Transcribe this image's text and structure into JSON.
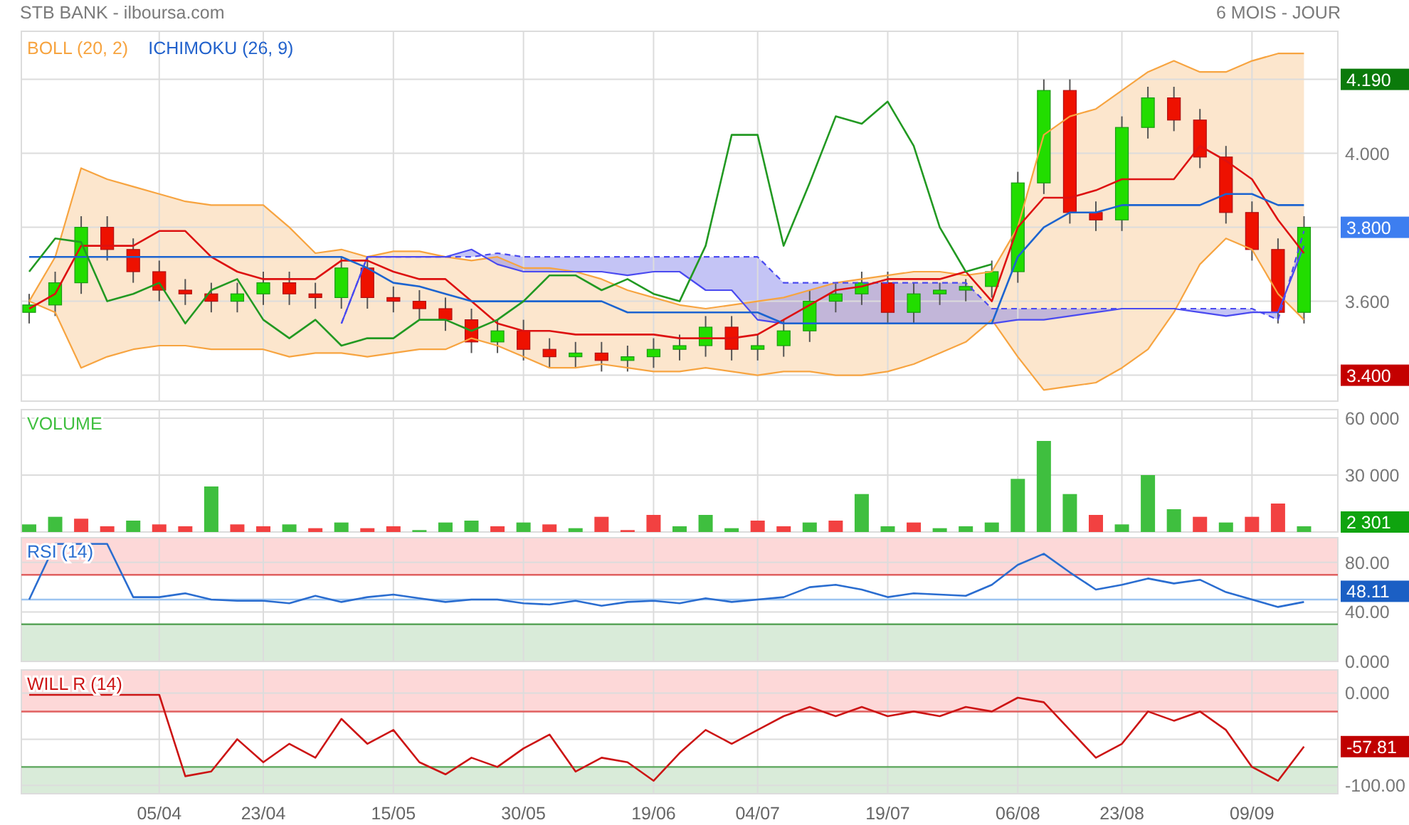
{
  "header": {
    "title": "STB BANK - ilboursa.com",
    "period": "6 MOIS - JOUR"
  },
  "price_panel": {
    "indicators": [
      {
        "label": "BOLL (20, 2)",
        "color": "#f7a440"
      },
      {
        "label": "ICHIMOKU (26, 9)",
        "color": "#2262cc"
      }
    ],
    "badges": [
      {
        "color": "#c40000"
      },
      {
        "color": "#3d7ef0"
      },
      {
        "color": "#0b7a0b"
      }
    ],
    "candles": {
      "chart_data": {
        "type": "candlestick",
        "grid": true,
        "categories": [
          null,
          null,
          null,
          null,
          null,
          null,
          null,
          null,
          null,
          null,
          null,
          null,
          null,
          null,
          null,
          null,
          null,
          null,
          null,
          null,
          null,
          null,
          null,
          null,
          null,
          null,
          null,
          null,
          null,
          null,
          null,
          null,
          null,
          null,
          null,
          null,
          null,
          null,
          null,
          null,
          null,
          null,
          null,
          null,
          null,
          null,
          null,
          null,
          null,
          null
        ],
        "ylim": [
          3.33,
          4.33
        ],
        "yticks": [
          {
            "value": 3.4,
            "label": "3.400"
          },
          {
            "value": 3.8,
            "label": "3.800"
          }
        ],
        "ohlc": [
          [
            3.57,
            3.62,
            3.54,
            3.59
          ],
          [
            3.59,
            3.68,
            3.56,
            3.65
          ],
          [
            3.65,
            3.83,
            3.62,
            3.8
          ],
          [
            3.8,
            3.83,
            3.71,
            3.74
          ],
          [
            3.74,
            3.77,
            3.65,
            3.68
          ],
          [
            3.68,
            3.71,
            3.6,
            3.63
          ],
          [
            3.63,
            3.66,
            3.59,
            3.62
          ],
          [
            3.62,
            3.65,
            3.57,
            3.6
          ],
          [
            3.6,
            3.65,
            3.57,
            3.62
          ],
          [
            3.62,
            3.68,
            3.59,
            3.65
          ],
          [
            3.65,
            3.68,
            3.59,
            3.62
          ],
          [
            3.62,
            3.65,
            3.58,
            3.61
          ],
          [
            3.61,
            3.72,
            3.58,
            3.69
          ],
          [
            3.69,
            3.72,
            3.58,
            3.61
          ],
          [
            3.61,
            3.64,
            3.57,
            3.6
          ],
          [
            3.6,
            3.63,
            3.55,
            3.58
          ],
          [
            3.58,
            3.61,
            3.52,
            3.55
          ],
          [
            3.55,
            3.58,
            3.46,
            3.49
          ],
          [
            3.49,
            3.55,
            3.46,
            3.52
          ],
          [
            3.52,
            3.55,
            3.44,
            3.47
          ],
          [
            3.47,
            3.5,
            3.42,
            3.45
          ],
          [
            3.45,
            3.49,
            3.42,
            3.46
          ],
          [
            3.46,
            3.49,
            3.41,
            3.44
          ],
          [
            3.44,
            3.48,
            3.41,
            3.45
          ],
          [
            3.45,
            3.5,
            3.42,
            3.47
          ],
          [
            3.47,
            3.51,
            3.44,
            3.48
          ],
          [
            3.48,
            3.56,
            3.45,
            3.53
          ],
          [
            3.53,
            3.56,
            3.44,
            3.47
          ],
          [
            3.47,
            3.51,
            3.44,
            3.48
          ],
          [
            3.48,
            3.55,
            3.45,
            3.52
          ],
          [
            3.52,
            3.63,
            3.49,
            3.6
          ],
          [
            3.6,
            3.65,
            3.57,
            3.62
          ],
          [
            3.62,
            3.68,
            3.59,
            3.65
          ],
          [
            3.65,
            3.68,
            3.54,
            3.57
          ],
          [
            3.57,
            3.65,
            3.54,
            3.62
          ],
          [
            3.62,
            3.65,
            3.59,
            3.63
          ],
          [
            3.63,
            3.66,
            3.6,
            3.64
          ],
          [
            3.64,
            3.71,
            3.61,
            3.68
          ],
          [
            3.68,
            3.95,
            3.65,
            3.92
          ],
          [
            3.92,
            4.2,
            3.89,
            4.17
          ],
          [
            4.17,
            4.2,
            3.81,
            3.84
          ],
          [
            3.84,
            3.87,
            3.79,
            3.82
          ],
          [
            3.82,
            4.1,
            3.79,
            4.07
          ],
          [
            4.07,
            4.18,
            4.04,
            4.15
          ],
          [
            4.15,
            4.18,
            4.06,
            4.09
          ],
          [
            4.09,
            4.12,
            3.96,
            3.99
          ],
          [
            3.99,
            4.02,
            3.81,
            3.84
          ],
          [
            3.84,
            3.87,
            3.71,
            3.74
          ],
          [
            3.74,
            3.77,
            3.54,
            3.57
          ],
          [
            3.57,
            3.83,
            3.54,
            3.8
          ]
        ],
        "annotations": [
          "4.190"
        ]
      }
    },
    "overlays": {
      "chart_data": {
        "type": "line",
        "categories": [
          null,
          null,
          null,
          null,
          null,
          null,
          null,
          null,
          null,
          null,
          null,
          null,
          null,
          null,
          null,
          null,
          null,
          null,
          null,
          null,
          null,
          null,
          null,
          null,
          null,
          null,
          null,
          null,
          null,
          null,
          null,
          null,
          null,
          null,
          null,
          null,
          null,
          null,
          null,
          null,
          null,
          null,
          null,
          null,
          null,
          null,
          null,
          null,
          null,
          null
        ],
        "ylim": [
          3.33,
          4.33
        ],
        "yticks": [
          {
            "value": 3.6,
            "label": "3.600"
          },
          {
            "value": 4.0,
            "label": "4.000"
          }
        ],
        "series": [
          {
            "color": "#f7a440",
            "values": [
              3.6,
              3.72,
              3.96,
              3.93,
              3.91,
              3.89,
              3.87,
              3.86,
              3.86,
              3.86,
              3.8,
              3.73,
              3.74,
              3.72,
              3.735,
              3.735,
              3.72,
              3.71,
              3.72,
              3.69,
              3.69,
              3.68,
              3.66,
              3.63,
              3.61,
              3.59,
              3.58,
              3.59,
              3.6,
              3.61,
              3.63,
              3.65,
              3.66,
              3.67,
              3.68,
              3.68,
              3.67,
              3.68,
              3.8,
              4.05,
              4.1,
              4.12,
              4.17,
              4.22,
              4.25,
              4.22,
              4.22,
              4.25,
              4.27,
              4.27
            ]
          },
          {
            "color": "#f7a440",
            "values": [
              3.6,
              3.57,
              3.42,
              3.45,
              3.47,
              3.48,
              3.48,
              3.47,
              3.47,
              3.47,
              3.45,
              3.46,
              3.46,
              3.45,
              3.46,
              3.47,
              3.47,
              3.5,
              3.48,
              3.45,
              3.42,
              3.42,
              3.43,
              3.42,
              3.41,
              3.41,
              3.42,
              3.41,
              3.4,
              3.41,
              3.41,
              3.4,
              3.4,
              3.41,
              3.43,
              3.46,
              3.49,
              3.55,
              3.45,
              3.36,
              3.37,
              3.38,
              3.42,
              3.47,
              3.57,
              3.7,
              3.77,
              3.74,
              3.62,
              3.55
            ]
          },
          {
            "color": "#4a4af0",
            "line_style": "dashed",
            "values": [
              null,
              null,
              null,
              null,
              null,
              null,
              null,
              null,
              null,
              null,
              null,
              null,
              3.54,
              3.72,
              3.72,
              3.72,
              3.72,
              3.72,
              3.73,
              3.72,
              3.72,
              3.72,
              3.72,
              3.72,
              3.72,
              3.72,
              3.72,
              3.72,
              3.72,
              3.65,
              3.65,
              3.65,
              3.65,
              3.65,
              3.65,
              3.65,
              3.65,
              3.58,
              3.58,
              3.58,
              3.58,
              3.58,
              3.58,
              3.58,
              3.58,
              3.58,
              3.58,
              3.58,
              3.55,
              3.79
            ]
          },
          {
            "color": "#4a4af0",
            "values": [
              null,
              null,
              null,
              null,
              null,
              null,
              null,
              null,
              null,
              null,
              null,
              null,
              3.54,
              3.72,
              3.72,
              3.72,
              3.72,
              3.74,
              3.7,
              3.68,
              3.68,
              3.68,
              3.68,
              3.67,
              3.68,
              3.68,
              3.63,
              3.63,
              3.55,
              3.54,
              3.54,
              3.54,
              3.54,
              3.54,
              3.54,
              3.54,
              3.54,
              3.54,
              3.55,
              3.55,
              3.56,
              3.57,
              3.58,
              3.58,
              3.58,
              3.57,
              3.56,
              3.57,
              3.57,
              3.75
            ]
          },
          {
            "color": "#dd1111",
            "values": [
              3.58,
              3.62,
              3.75,
              3.75,
              3.75,
              3.79,
              3.79,
              3.72,
              3.68,
              3.66,
              3.66,
              3.66,
              3.71,
              3.71,
              3.68,
              3.66,
              3.66,
              3.6,
              3.54,
              3.52,
              3.52,
              3.51,
              3.51,
              3.51,
              3.51,
              3.5,
              3.5,
              3.5,
              3.51,
              3.55,
              3.59,
              3.63,
              3.64,
              3.66,
              3.66,
              3.66,
              3.68,
              3.6,
              3.8,
              3.88,
              3.88,
              3.9,
              3.93,
              3.93,
              3.93,
              4.02,
              3.98,
              3.93,
              3.82,
              3.73
            ]
          },
          {
            "color": "#1c64d0",
            "values": [
              3.72,
              3.72,
              3.72,
              3.72,
              3.72,
              3.72,
              3.72,
              3.72,
              3.72,
              3.72,
              3.72,
              3.72,
              3.72,
              3.69,
              3.65,
              3.64,
              3.62,
              3.6,
              3.6,
              3.6,
              3.6,
              3.6,
              3.6,
              3.57,
              3.57,
              3.57,
              3.57,
              3.57,
              3.57,
              3.54,
              3.54,
              3.54,
              3.54,
              3.54,
              3.54,
              3.54,
              3.54,
              3.54,
              3.72,
              3.8,
              3.84,
              3.84,
              3.86,
              3.86,
              3.86,
              3.86,
              3.89,
              3.89,
              3.86,
              3.86
            ]
          },
          {
            "color": "#229922",
            "values": [
              3.68,
              3.77,
              3.76,
              3.6,
              3.62,
              3.65,
              3.54,
              3.63,
              3.66,
              3.55,
              3.5,
              3.55,
              3.48,
              3.5,
              3.5,
              3.55,
              3.55,
              3.52,
              3.55,
              3.6,
              3.67,
              3.67,
              3.63,
              3.66,
              3.62,
              3.6,
              3.75,
              4.05,
              4.05,
              3.75,
              3.92,
              4.1,
              4.08,
              4.14,
              4.02,
              3.8,
              3.68,
              3.7,
              null,
              null,
              null,
              null,
              null,
              null,
              null,
              null,
              null,
              null,
              null,
              null
            ]
          }
        ]
      }
    }
  },
  "volume_panel": {
    "badges": [
      {
        "color": "#0fa40f"
      }
    ],
    "chart_data": {
      "type": "bar",
      "title": "VOLUME",
      "grid": true,
      "categories": [
        null,
        null,
        null,
        null,
        null,
        null,
        null,
        null,
        null,
        null,
        null,
        null,
        null,
        null,
        null,
        null,
        null,
        null,
        null,
        null,
        null,
        null,
        null,
        null,
        null,
        null,
        null,
        null,
        null,
        null,
        null,
        null,
        null,
        null,
        null,
        null,
        null,
        null,
        null,
        null,
        null,
        null,
        null,
        null,
        null,
        null,
        null,
        null,
        null,
        null
      ],
      "ylim": [
        0,
        64500
      ],
      "yticks": [
        {
          "value": 30000,
          "label": "30 000"
        },
        {
          "value": 60000,
          "label": "60 000"
        }
      ],
      "series": [
        {
          "color": "#3fbf3f",
          "values": [
            4000,
            8000,
            null,
            null,
            6000,
            null,
            null,
            24000,
            null,
            null,
            4000,
            null,
            5000,
            null,
            null,
            1000,
            5000,
            6000,
            null,
            5000,
            null,
            2000,
            null,
            null,
            null,
            3000,
            9000,
            2000,
            null,
            null,
            5000,
            null,
            20000,
            3000,
            null,
            2000,
            3000,
            5000,
            28000,
            48000,
            20000,
            null,
            4000,
            30000,
            12000,
            null,
            5000,
            null,
            null,
            3000
          ]
        },
        {
          "color": "#f24141",
          "values": [
            null,
            null,
            7000,
            3000,
            null,
            4000,
            3000,
            null,
            4000,
            3000,
            null,
            2000,
            null,
            2000,
            3000,
            null,
            null,
            null,
            3000,
            null,
            4000,
            null,
            8000,
            1000,
            9000,
            null,
            null,
            null,
            6000,
            3000,
            null,
            6000,
            null,
            null,
            5000,
            null,
            null,
            null,
            null,
            null,
            null,
            9000,
            null,
            null,
            null,
            8000,
            null,
            8000,
            15000,
            null
          ]
        }
      ],
      "annotations": [
        "2 301"
      ]
    }
  },
  "rsi_panel": {
    "badges": [
      {
        "color": "#1b5fc4"
      }
    ],
    "chart_data": {
      "type": "line",
      "title": "RSI (14)",
      "grid": true,
      "categories": [
        null,
        null,
        null,
        null,
        null,
        null,
        null,
        null,
        null,
        null,
        null,
        null,
        null,
        null,
        null,
        null,
        null,
        null,
        null,
        null,
        null,
        null,
        null,
        null,
        null,
        null,
        null,
        null,
        null,
        null,
        null,
        null,
        null,
        null,
        null,
        null,
        null,
        null,
        null,
        null,
        null,
        null,
        null,
        null,
        null,
        null,
        null,
        null,
        null,
        null
      ],
      "ylim": [
        0,
        100
      ],
      "yticks": [
        {
          "value": 0,
          "label": "0.000"
        },
        {
          "value": 40,
          "label": "40.00"
        },
        {
          "value": 80,
          "label": "80.00"
        }
      ],
      "series": [
        {
          "color": "#2a6dd0",
          "values": [
            50,
            95,
            95,
            95,
            52,
            52,
            55,
            50,
            49,
            49,
            47,
            53,
            48,
            52,
            54,
            51,
            48,
            50,
            50,
            47,
            46,
            49,
            45,
            48,
            49,
            47,
            51,
            48,
            50,
            52,
            60,
            62,
            58,
            52,
            55,
            54,
            53,
            62,
            78,
            87,
            72,
            58,
            62,
            67,
            63,
            66,
            56,
            50,
            44,
            48
          ]
        }
      ],
      "bands": [
        {
          "axis": "y",
          "from": 70,
          "to": 100,
          "color": "#fdd8d8"
        },
        {
          "axis": "y",
          "from": 0,
          "to": 30,
          "color": "#d9ebd9"
        }
      ],
      "ref_lines": [
        {
          "axis": "y",
          "value": 70,
          "color": "#e06060"
        },
        {
          "axis": "y",
          "value": 30,
          "color": "#5aa55a"
        },
        {
          "axis": "y",
          "value": 50,
          "color": "#9cc4f0"
        }
      ],
      "annotations": [
        "48.11"
      ]
    }
  },
  "willr_panel": {
    "badges": [
      {
        "color": "#c00000"
      }
    ],
    "chart_data": {
      "type": "line",
      "title": "WILL R (14)",
      "categories": [
        null,
        null,
        null,
        null,
        null,
        "05/04",
        null,
        null,
        null,
        "23/04",
        null,
        null,
        null,
        null,
        "15/05",
        null,
        null,
        null,
        null,
        "30/05",
        null,
        null,
        null,
        null,
        "19/06",
        null,
        null,
        null,
        "04/07",
        null,
        null,
        null,
        null,
        "19/07",
        null,
        null,
        null,
        null,
        "06/08",
        null,
        null,
        null,
        "23/08",
        null,
        null,
        null,
        null,
        "09/09",
        null,
        null
      ],
      "grid": true,
      "ylim": [
        -109,
        25
      ],
      "yticks": [
        {
          "value": -100,
          "label": "-100.00"
        },
        {
          "value": 0,
          "label": "0.000"
        }
      ],
      "series": [
        {
          "color": "#cc1414",
          "values": [
            -2,
            -2,
            -2,
            -2,
            -2,
            -2,
            -90,
            -85,
            -50,
            -75,
            -55,
            -70,
            -28,
            -55,
            -40,
            -75,
            -88,
            -70,
            -80,
            -60,
            -45,
            -85,
            -70,
            -75,
            -95,
            -65,
            -40,
            -55,
            -40,
            -25,
            -15,
            -25,
            -15,
            -25,
            -20,
            -25,
            -15,
            -20,
            -5,
            -10,
            -40,
            -70,
            -55,
            -20,
            -30,
            -20,
            -40,
            -80,
            -95,
            -58
          ]
        }
      ],
      "bands": [
        {
          "axis": "y",
          "from": -20,
          "to": 25,
          "color": "#fdd8d8"
        },
        {
          "axis": "y",
          "from": -109,
          "to": -80,
          "color": "#d9ebd9"
        }
      ],
      "ref_lines": [
        {
          "axis": "y",
          "value": -20,
          "color": "#e06060"
        },
        {
          "axis": "y",
          "value": -80,
          "color": "#5aa55a"
        }
      ],
      "annotations": [
        "-57.81"
      ]
    }
  }
}
